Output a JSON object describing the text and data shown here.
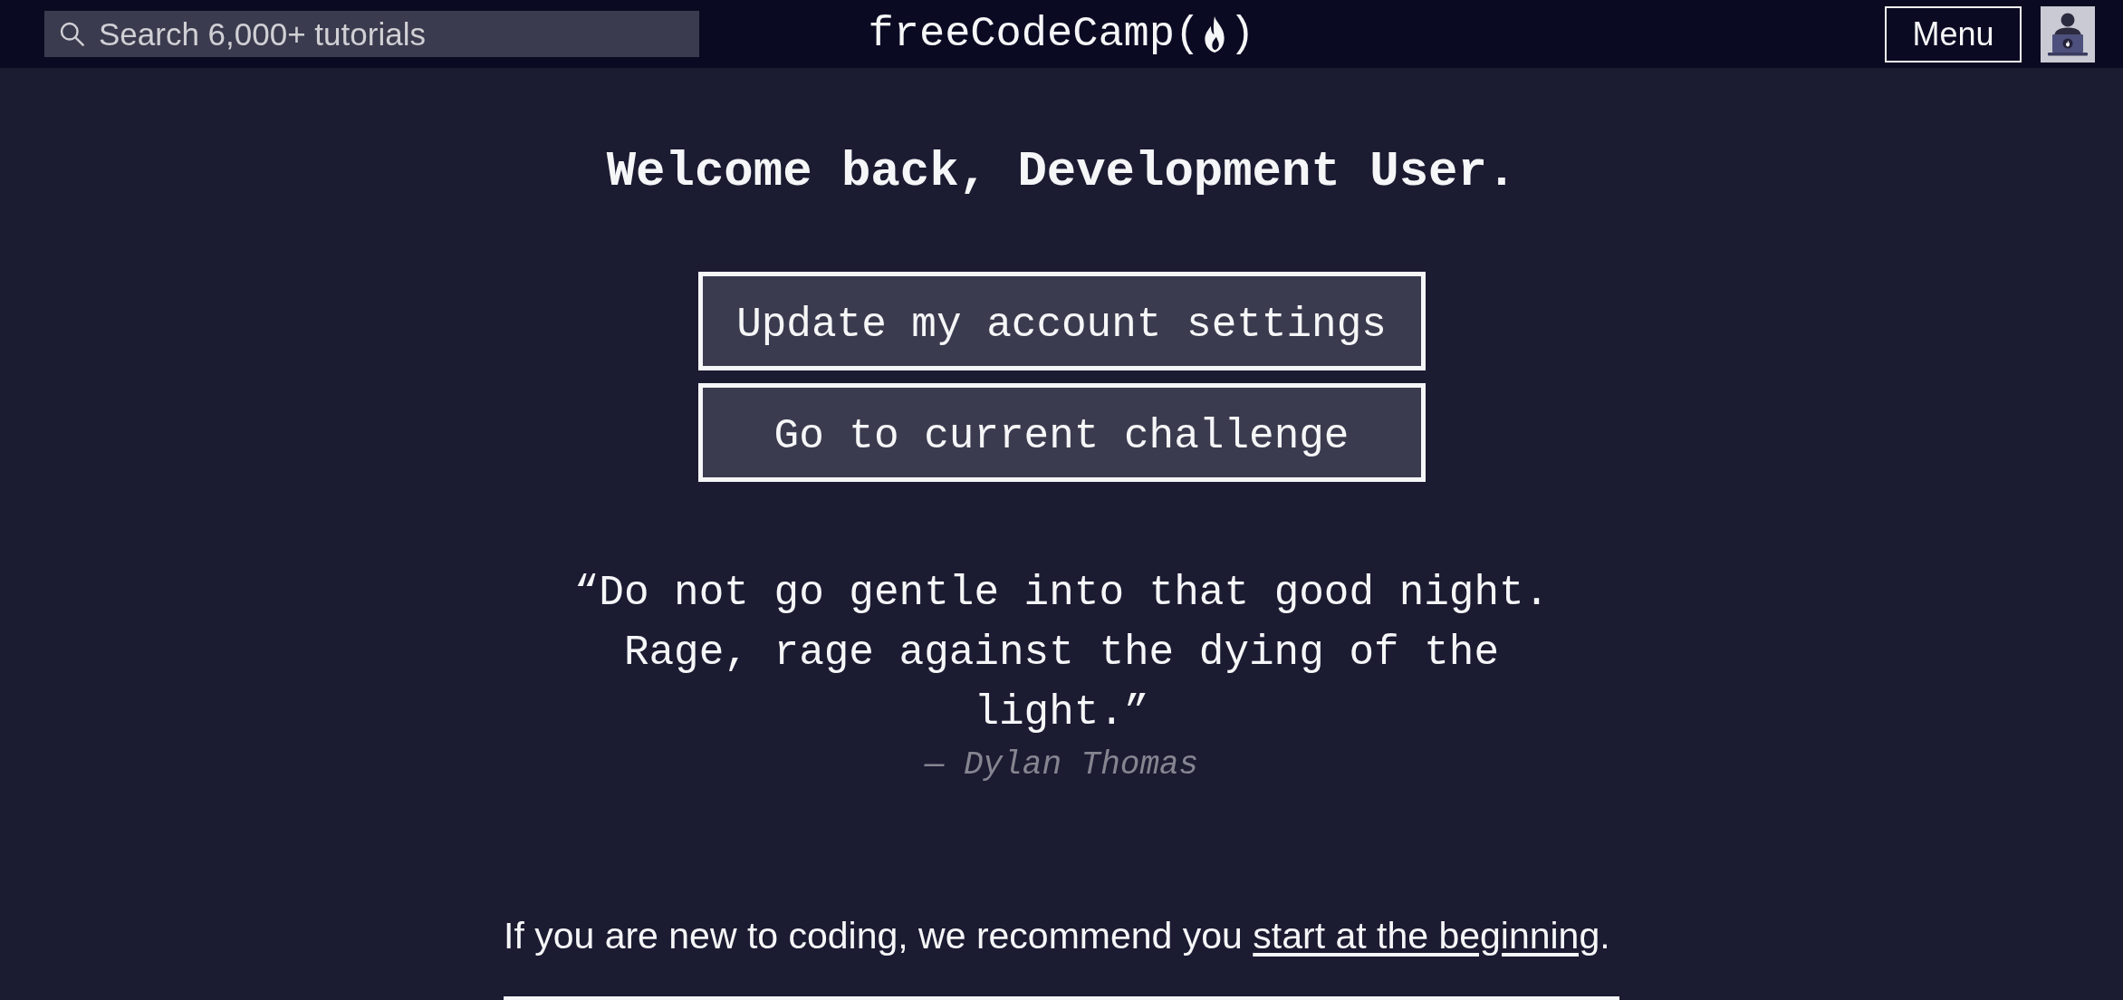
{
  "nav": {
    "search": {
      "placeholder": "Search 6,000+ tutorials"
    },
    "logo": {
      "text_before": "freeCodeCamp(",
      "text_after": ")"
    },
    "menu_button": "Menu"
  },
  "main": {
    "heading": "Welcome back, Development User.",
    "buttons": [
      "Update my account settings",
      "Go to current challenge"
    ],
    "quote": {
      "text": "“Do not go gentle into that good night. Rage, rage against the dying of the light.”",
      "author": "— Dylan Thomas"
    },
    "intro": {
      "text_before": "If you are new to coding, we recommend you ",
      "link": "start at the beginning",
      "text_after": "."
    }
  }
}
